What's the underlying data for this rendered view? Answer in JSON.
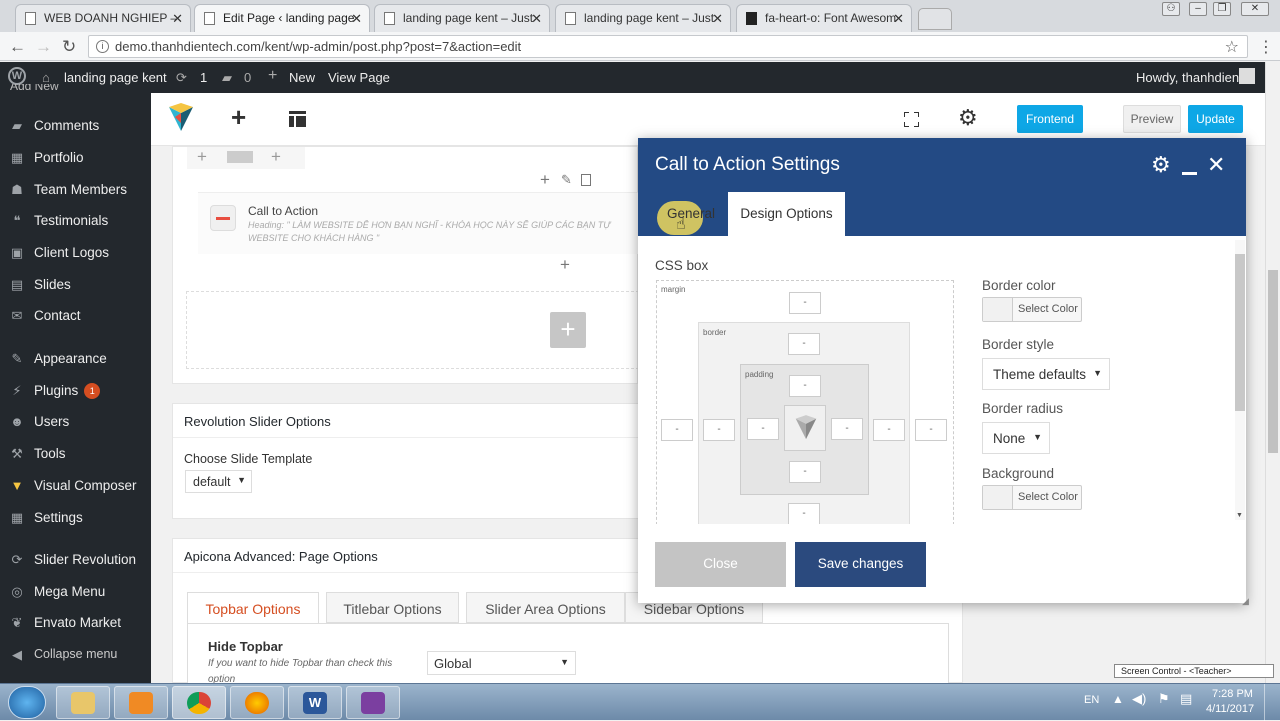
{
  "browser": {
    "tabs": [
      {
        "title": "WEB DOANH NGHIEP – ",
        "active": false
      },
      {
        "title": "Edit Page ‹ landing page",
        "active": true
      },
      {
        "title": "landing page kent – Just",
        "active": false
      },
      {
        "title": "landing page kent – Just",
        "active": false
      },
      {
        "title": "fa-heart-o: Font Awesom",
        "active": false
      }
    ],
    "url": "demo.thanhdientech.com/kent/wp-admin/post.php?post=7&action=edit"
  },
  "adminbar": {
    "site": "landing page kent",
    "updates": "1",
    "comments": "0",
    "new": "New",
    "view_page": "View Page",
    "howdy": "Howdy, thanhdien"
  },
  "sidebar": {
    "cut_item": "Add New",
    "items": [
      {
        "label": "Comments",
        "icon": "comment-icon"
      },
      {
        "label": "Portfolio",
        "icon": "grid-icon"
      },
      {
        "label": "Team Members",
        "icon": "team-icon"
      },
      {
        "label": "Testimonials",
        "icon": "quote-icon"
      },
      {
        "label": "Client Logos",
        "icon": "logos-icon"
      },
      {
        "label": "Slides",
        "icon": "slides-icon"
      },
      {
        "label": "Contact",
        "icon": "mail-icon"
      },
      {
        "label": "Appearance",
        "icon": "brush-icon"
      },
      {
        "label": "Plugins",
        "icon": "plugin-icon",
        "badge": "1"
      },
      {
        "label": "Users",
        "icon": "user-icon"
      },
      {
        "label": "Tools",
        "icon": "wrench-icon"
      },
      {
        "label": "Visual Composer",
        "icon": "vc-icon"
      },
      {
        "label": "Settings",
        "icon": "settings-icon"
      },
      {
        "label": "Slider Revolution",
        "icon": "refresh-icon"
      },
      {
        "label": "Mega Menu",
        "icon": "megamenu-icon"
      },
      {
        "label": "Envato Market",
        "icon": "leaf-icon"
      },
      {
        "label": "Collapse menu",
        "icon": "collapse-icon"
      }
    ]
  },
  "vc_toolbar": {
    "frontend": "Frontend",
    "preview": "Preview",
    "update": "Update"
  },
  "element": {
    "title": "Call to Action",
    "heading_line1": "Heading: \" LÀM WEBSITE DỄ HƠN BẠN NGHĨ - KHÓA HỌC NÀY SẼ GIÚP CÁC BẠN TỰ",
    "heading_line2": "WEBSITE CHO KHÁCH HÀNG \""
  },
  "revslider": {
    "title": "Revolution Slider Options",
    "label": "Choose Slide Template",
    "value": "default"
  },
  "apicona": {
    "title": "Apicona Advanced: Page Options",
    "tabs": [
      "Topbar Options",
      "Titlebar Options",
      "Slider Area Options",
      "Sidebar Options"
    ],
    "hide_topbar": "Hide Topbar",
    "hint": "If you want to hide Topbar than check this",
    "hint2": "option",
    "select": "Global"
  },
  "modal": {
    "title": "Call to Action Settings",
    "tabs": [
      "General",
      "Design Options"
    ],
    "css_box": "CSS box",
    "margin": "margin",
    "border": "border",
    "padding": "padding",
    "dash": "-",
    "border_color": "Border color",
    "select_color": "Select Color",
    "border_style": "Border style",
    "border_style_value": "Theme defaults",
    "border_radius": "Border radius",
    "border_radius_value": "None",
    "background": "Background",
    "close": "Close",
    "save": "Save changes"
  },
  "taskbar": {
    "lang": "EN",
    "time": "7:28 PM",
    "date": "4/11/2017",
    "screen_control": "Screen Control - <Teacher>"
  },
  "colors": {
    "wp_dark": "#23282d",
    "modal_header": "#234a84",
    "vc_blue": "#0ea7e6",
    "save_button": "#2b4a7e"
  }
}
